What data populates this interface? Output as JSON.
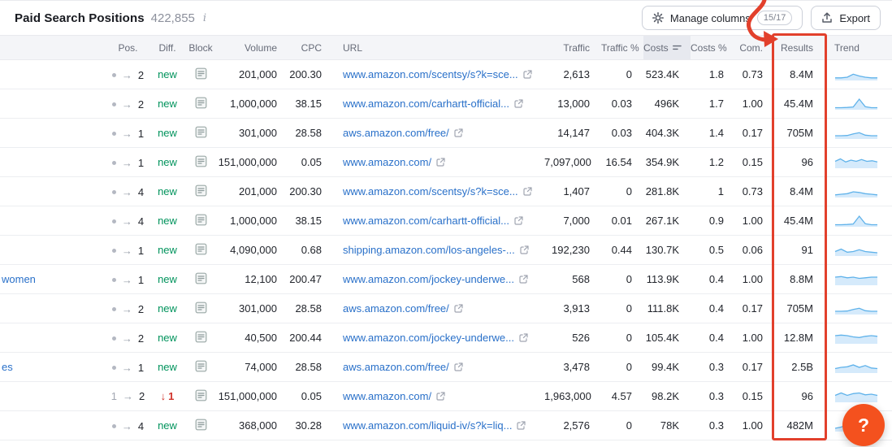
{
  "panel": {
    "title": "Paid Search Positions",
    "count": "422,855"
  },
  "toolbar": {
    "manage_columns_label": "Manage columns",
    "manage_columns_badge": "15/17",
    "export_label": "Export"
  },
  "table": {
    "columns": [
      "",
      "Pos.",
      "Diff.",
      "Block",
      "Volume",
      "CPC",
      "URL",
      "Traffic",
      "Traffic %",
      "Costs",
      "Costs %",
      "Com.",
      "Results",
      "Trend"
    ],
    "sorted_column": "Costs",
    "rows": [
      {
        "keyword": "",
        "pos": {
          "from": "dot",
          "to": "2"
        },
        "diff": {
          "type": "new",
          "label": "new"
        },
        "volume": "201,000",
        "cpc": "200.30",
        "url": "www.amazon.com/scentsy/s?k=sce...",
        "traffic": "2,613",
        "traffic_pct": "0",
        "costs": "523.4K",
        "costs_pct": "1.8",
        "com": "0.73",
        "results": "8.4M",
        "trend": [
          1.5,
          1.5,
          2,
          4.5,
          3,
          2,
          1.5,
          1.5
        ]
      },
      {
        "keyword": "",
        "pos": {
          "from": "dot",
          "to": "2"
        },
        "diff": {
          "type": "new",
          "label": "new"
        },
        "volume": "1,000,000",
        "cpc": "38.15",
        "url": "www.amazon.com/carhartt-official...",
        "traffic": "13,000",
        "traffic_pct": "0.03",
        "costs": "496K",
        "costs_pct": "1.7",
        "com": "1.00",
        "results": "45.4M",
        "trend": [
          1,
          1,
          1.2,
          1.6,
          8,
          1.8,
          1,
          1
        ]
      },
      {
        "keyword": "",
        "pos": {
          "from": "dot",
          "to": "1"
        },
        "diff": {
          "type": "new",
          "label": "new"
        },
        "volume": "301,000",
        "cpc": "28.58",
        "url": "aws.amazon.com/free/",
        "traffic": "14,147",
        "traffic_pct": "0.03",
        "costs": "404.3K",
        "costs_pct": "1.4",
        "com": "0.17",
        "results": "705M",
        "trend": [
          2,
          2,
          2.2,
          3.5,
          4.5,
          2.5,
          2,
          2
        ]
      },
      {
        "keyword": "",
        "pos": {
          "from": "dot",
          "to": "1"
        },
        "diff": {
          "type": "new",
          "label": "new"
        },
        "volume": "151,000,000",
        "cpc": "0.05",
        "url": "www.amazon.com/",
        "traffic": "7,097,000",
        "traffic_pct": "16.54",
        "costs": "354.9K",
        "costs_pct": "1.2",
        "com": "0.15",
        "results": "96",
        "trend": [
          5,
          7,
          4.5,
          6,
          5,
          6.5,
          5,
          5.5,
          4.5
        ]
      },
      {
        "keyword": "",
        "pos": {
          "from": "dot",
          "to": "4"
        },
        "diff": {
          "type": "new",
          "label": "new"
        },
        "volume": "201,000",
        "cpc": "200.30",
        "url": "www.amazon.com/scentsy/s?k=sce...",
        "traffic": "1,407",
        "traffic_pct": "0",
        "costs": "281.8K",
        "costs_pct": "1",
        "com": "0.73",
        "results": "8.4M",
        "trend": [
          1.5,
          2,
          2.5,
          4,
          3.5,
          2.5,
          2,
          1.5
        ]
      },
      {
        "keyword": "",
        "pos": {
          "from": "dot",
          "to": "4"
        },
        "diff": {
          "type": "new",
          "label": "new"
        },
        "volume": "1,000,000",
        "cpc": "38.15",
        "url": "www.amazon.com/carhartt-official...",
        "traffic": "7,000",
        "traffic_pct": "0.01",
        "costs": "267.1K",
        "costs_pct": "0.9",
        "com": "1.00",
        "results": "45.4M",
        "trend": [
          1,
          1,
          1.2,
          1.6,
          8,
          1.8,
          1,
          1
        ]
      },
      {
        "keyword": "",
        "pos": {
          "from": "dot",
          "to": "1"
        },
        "diff": {
          "type": "new",
          "label": "new"
        },
        "volume": "4,090,000",
        "cpc": "0.68",
        "url": "shipping.amazon.com/los-angeles-...",
        "traffic": "192,230",
        "traffic_pct": "0.44",
        "costs": "130.7K",
        "costs_pct": "0.5",
        "com": "0.06",
        "results": "91",
        "trend": [
          3,
          5,
          2.5,
          3,
          4.5,
          3,
          2.5,
          2
        ]
      },
      {
        "keyword": "women",
        "pos": {
          "from": "dot",
          "to": "1"
        },
        "diff": {
          "type": "new",
          "label": "new"
        },
        "volume": "12,100",
        "cpc": "200.47",
        "url": "www.amazon.com/jockey-underwe...",
        "traffic": "568",
        "traffic_pct": "0",
        "costs": "113.9K",
        "costs_pct": "0.4",
        "com": "1.00",
        "results": "8.8M",
        "trend": [
          6,
          6.5,
          5.5,
          6,
          5,
          5.5,
          6,
          6
        ]
      },
      {
        "keyword": "",
        "pos": {
          "from": "dot",
          "to": "2"
        },
        "diff": {
          "type": "new",
          "label": "new"
        },
        "volume": "301,000",
        "cpc": "28.58",
        "url": "aws.amazon.com/free/",
        "traffic": "3,913",
        "traffic_pct": "0",
        "costs": "111.8K",
        "costs_pct": "0.4",
        "com": "0.17",
        "results": "705M",
        "trend": [
          2,
          2,
          2.2,
          3.5,
          4.5,
          2.5,
          2,
          2
        ]
      },
      {
        "keyword": "",
        "pos": {
          "from": "dot",
          "to": "2"
        },
        "diff": {
          "type": "new",
          "label": "new"
        },
        "volume": "40,500",
        "cpc": "200.44",
        "url": "www.amazon.com/jockey-underwe...",
        "traffic": "526",
        "traffic_pct": "0",
        "costs": "105.4K",
        "costs_pct": "0.4",
        "com": "1.00",
        "results": "12.8M",
        "trend": [
          6,
          6.5,
          6,
          5,
          4.5,
          5.5,
          6,
          5.5
        ]
      },
      {
        "keyword": "es",
        "pos": {
          "from": "dot",
          "to": "1"
        },
        "diff": {
          "type": "new",
          "label": "new"
        },
        "volume": "74,000",
        "cpc": "28.58",
        "url": "aws.amazon.com/free/",
        "traffic": "3,478",
        "traffic_pct": "0",
        "costs": "99.4K",
        "costs_pct": "0.3",
        "com": "0.17",
        "results": "2.5B",
        "trend": [
          3,
          4,
          4.5,
          6,
          4,
          5.5,
          3.5,
          3
        ]
      },
      {
        "keyword": "",
        "pos": {
          "from": "1",
          "to": "2"
        },
        "diff": {
          "type": "down",
          "label": "1",
          "arrow": "↓"
        },
        "volume": "151,000,000",
        "cpc": "0.05",
        "url": "www.amazon.com/",
        "traffic": "1,963,000",
        "traffic_pct": "4.57",
        "costs": "98.2K",
        "costs_pct": "0.3",
        "com": "0.15",
        "results": "96",
        "trend": [
          5,
          7,
          5,
          6.5,
          7,
          5.5,
          6,
          5
        ]
      },
      {
        "keyword": "",
        "pos": {
          "from": "dot",
          "to": "4"
        },
        "diff": {
          "type": "new",
          "label": "new"
        },
        "volume": "368,000",
        "cpc": "30.28",
        "url": "www.amazon.com/liquid-iv/s?k=liq...",
        "traffic": "2,576",
        "traffic_pct": "0",
        "costs": "78K",
        "costs_pct": "0.3",
        "com": "1.00",
        "results": "482M",
        "trend": [
          2,
          3,
          5,
          7,
          4.5,
          4.5,
          4.5,
          4.5
        ]
      }
    ]
  },
  "annotation": {
    "highlighted_column": "Results",
    "color": "#e2402c"
  },
  "help_button": {
    "label": "?",
    "color": "#f4511e"
  },
  "sparkline_colors": {
    "line": "#5fb2ea",
    "fill": "#d5eafb"
  }
}
